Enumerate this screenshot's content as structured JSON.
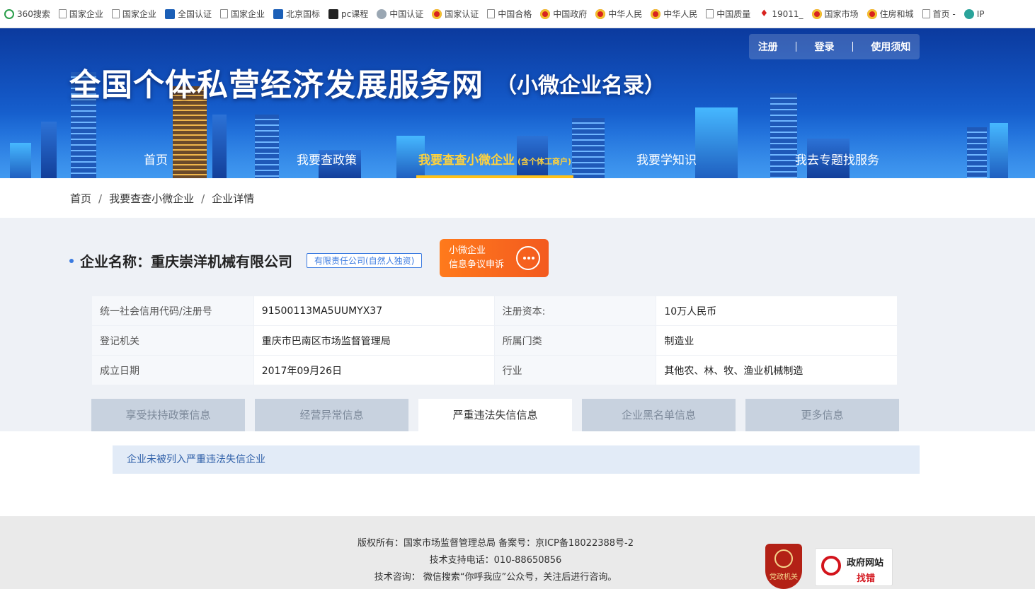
{
  "bookmarks": [
    {
      "label": "360搜索",
      "icon": "circle"
    },
    {
      "label": "国家企业",
      "icon": "page"
    },
    {
      "label": "国家企业",
      "icon": "page"
    },
    {
      "label": "全国认证",
      "icon": "blue"
    },
    {
      "label": "国家企业",
      "icon": "page"
    },
    {
      "label": "北京国标",
      "icon": "blue"
    },
    {
      "label": "pc课程",
      "icon": "dark"
    },
    {
      "label": "中国认证",
      "icon": "globe"
    },
    {
      "label": "国家认证",
      "icon": "emblem"
    },
    {
      "label": "中国合格",
      "icon": "page"
    },
    {
      "label": "中国政府",
      "icon": "emblem"
    },
    {
      "label": "中华人民",
      "icon": "emblem"
    },
    {
      "label": "中华人民",
      "icon": "emblem"
    },
    {
      "label": "中国质量",
      "icon": "page"
    },
    {
      "label": "19011_",
      "icon": "red"
    },
    {
      "label": "国家市场",
      "icon": "emblem"
    },
    {
      "label": "住房和城",
      "icon": "emblem"
    },
    {
      "label": "首页 -",
      "icon": "page"
    },
    {
      "label": "IP",
      "icon": "ip"
    }
  ],
  "header": {
    "title": "全国个体私营经济发展服务网",
    "subtitle": "（小微企业名录）",
    "top_links": [
      "注册",
      "登录",
      "使用须知"
    ]
  },
  "nav": {
    "items": [
      "首页",
      "我要查政策",
      "我要查查小微企业",
      "我要学知识",
      "我去专题找服务"
    ],
    "active_note": "(含个体工商户)"
  },
  "breadcrumb": [
    "首页",
    "我要查查小微企业",
    "企业详情"
  ],
  "company": {
    "label": "企业名称：",
    "name": "重庆崇洋机械有限公司",
    "type_tag": "有限责任公司(自然人独资)",
    "appeal_line1": "小微企业",
    "appeal_line2": "信息争议申诉"
  },
  "info_rows": [
    {
      "k1": "统一社会信用代码/注册号",
      "v1": "91500113MA5UUMYX37",
      "k2": "注册资本:",
      "v2": "10万人民币"
    },
    {
      "k1": "登记机关",
      "v1": "重庆市巴南区市场监督管理局",
      "k2": "所属门类",
      "v2": "制造业"
    },
    {
      "k1": "成立日期",
      "v1": "2017年09月26日",
      "k2": "行业",
      "v2": "其他农、林、牧、渔业机械制造"
    }
  ],
  "tabs": [
    "享受扶持政策信息",
    "经营异常信息",
    "严重违法失信信息",
    "企业黑名单信息",
    "更多信息"
  ],
  "active_tab": "严重违法失信信息",
  "notice": "企业未被列入严重违法失信企业",
  "footer": {
    "line1": "版权所有：国家市场监督管理总局 备案号：京ICP备18022388号-2",
    "line2": "技术支持电话：010-88650856",
    "line3": "技术咨询： 微信搜索“你呼我应”公众号，关注后进行咨询。",
    "badge_party": "党政机关",
    "badge_gov1": "政府网站",
    "badge_gov2": "找错"
  },
  "colors": {
    "accent": "#3a7ae0",
    "nav_active": "#ffd23c",
    "appeal": "#f35a1f",
    "banner": "#1356c4"
  }
}
